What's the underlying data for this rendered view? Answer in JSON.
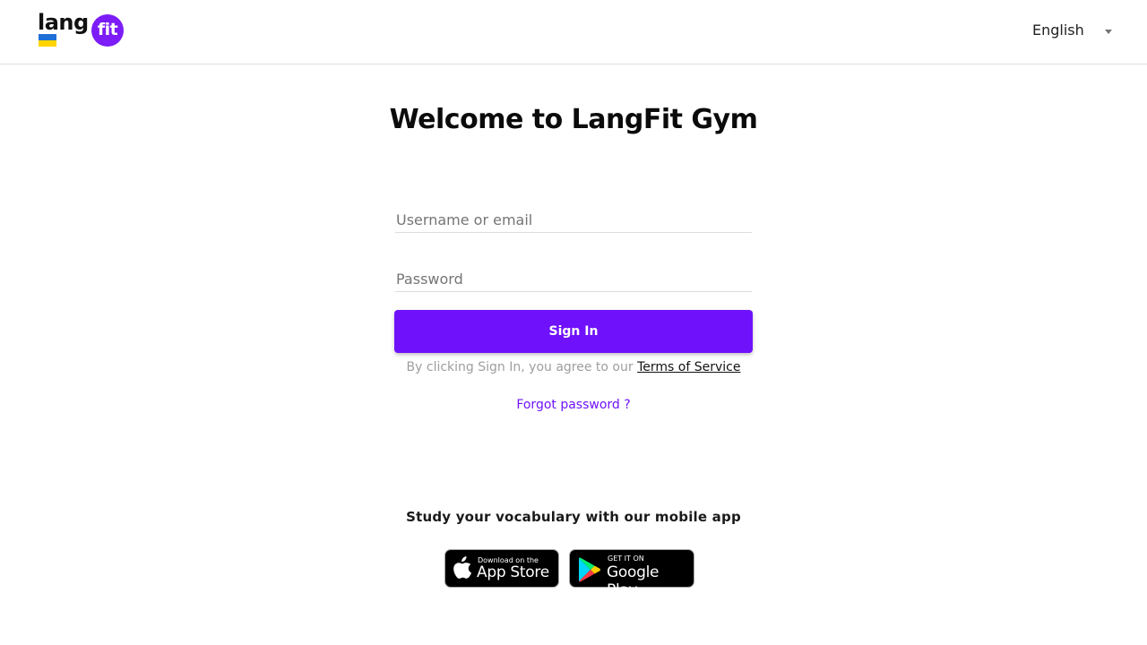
{
  "header": {
    "logo": {
      "text_part": "lang",
      "circle_part": "fit",
      "brand_color": "#7c1cf6"
    },
    "language": {
      "selected": "English"
    }
  },
  "login": {
    "title": "Welcome to LangFit Gym",
    "username_placeholder": "Username or email",
    "password_placeholder": "Password",
    "signin_label": "Sign In",
    "terms_prefix": "By clicking Sign In, you agree to our",
    "terms_link": "Terms of Service",
    "forgot_label": "Forgot password ?"
  },
  "mobile": {
    "promo": "Study your vocabulary with our mobile app",
    "appstore": {
      "small": "Download on the",
      "big": "App Store"
    },
    "google": {
      "small": "GET IT ON",
      "big": "Google Play"
    }
  },
  "colors": {
    "accent": "#6f12fb",
    "text": "#212121",
    "muted": "#9e9e9e"
  }
}
